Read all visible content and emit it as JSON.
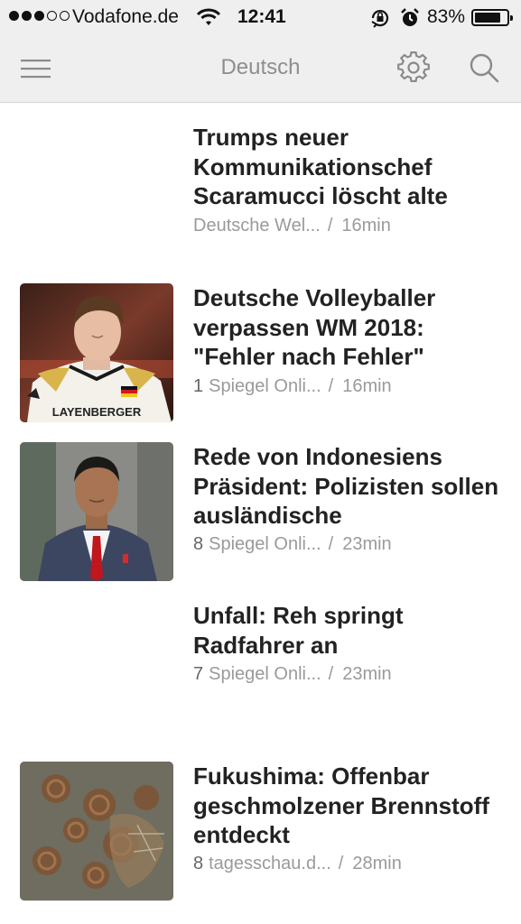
{
  "status_bar": {
    "carrier": "Vodafone.de",
    "time": "12:41",
    "battery_percent": "83%",
    "battery_level": 0.83,
    "signal_bars": 3,
    "signal_total": 5
  },
  "nav": {
    "title": "Deutsch"
  },
  "articles": [
    {
      "title": "Trumps neuer Kommunikationschef Scaramucci löscht alte",
      "count": "",
      "source": "Deutsche Wel...",
      "separator": "/",
      "age": "16min"
    },
    {
      "title": "Deutsche Volleyballer verpassen WM 2018: \"Fehler nach Fehler\"",
      "count": "1",
      "source": "Spiegel Onli...",
      "separator": "/",
      "age": "16min"
    },
    {
      "title": "Rede von Indonesiens Präsident: Polizisten sollen ausländische",
      "count": "8",
      "source": "Spiegel Onli...",
      "separator": "/",
      "age": "23min"
    },
    {
      "title": "Unfall: Reh springt Radfahrer an",
      "count": "7",
      "source": "Spiegel Onli...",
      "separator": "/",
      "age": "23min"
    },
    {
      "title": "Fukushima: Offenbar geschmolzener Brennstoff entdeckt",
      "count": "8",
      "source": "tagesschau.d...",
      "separator": "/",
      "age": "28min"
    }
  ],
  "thumb_images": {
    "volleyball": "LAYENBERGER"
  },
  "colors": {
    "bar_bg": "#efefef",
    "title_text": "#222222",
    "meta_text": "#9a9a9a",
    "nav_title": "#8e8e8e"
  }
}
